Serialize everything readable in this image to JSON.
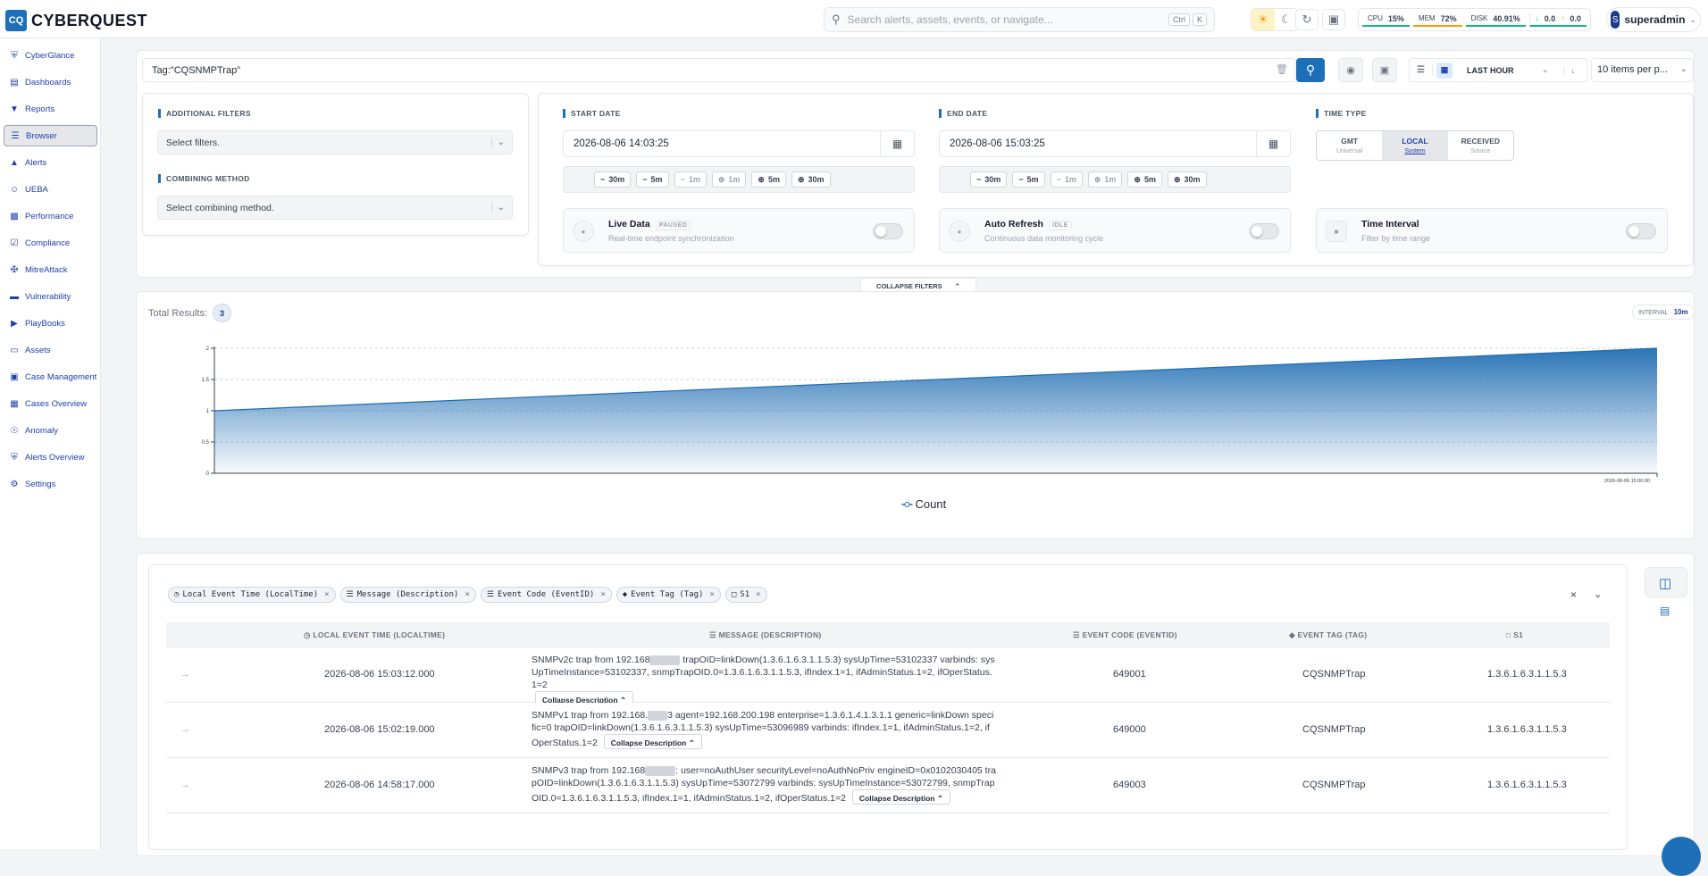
{
  "app": {
    "logo_mark": "CQ",
    "name": "CYBERQUEST"
  },
  "search": {
    "placeholder": "Search alerts, assets, events, or navigate...",
    "kbd1": "Ctrl",
    "kbd2": "K"
  },
  "metrics": [
    {
      "label": "CPU",
      "value": "15%"
    },
    {
      "label": "MEM",
      "value": "72%"
    },
    {
      "label": "DISK",
      "value": "40.91%"
    }
  ],
  "network": {
    "down": "0.0",
    "up": "0.0"
  },
  "user": {
    "initial": "S",
    "name": "superadmin"
  },
  "sidebar": {
    "items": [
      {
        "label": "CyberGlance",
        "icon": "shield-icon"
      },
      {
        "label": "Dashboards",
        "icon": "chart-icon"
      },
      {
        "label": "Reports",
        "icon": "filter-icon"
      },
      {
        "label": "Browser",
        "icon": "list-icon"
      },
      {
        "label": "Alerts",
        "icon": "bell-icon"
      },
      {
        "label": "UEBA",
        "icon": "user-icon"
      },
      {
        "label": "Performance",
        "icon": "gauge-icon"
      },
      {
        "label": "Compliance",
        "icon": "check-icon"
      },
      {
        "label": "MitreAttack",
        "icon": "target-icon"
      },
      {
        "label": "Vulnerability",
        "icon": "bug-icon"
      },
      {
        "label": "PlayBooks",
        "icon": "play-icon"
      },
      {
        "label": "Assets",
        "icon": "laptop-icon"
      },
      {
        "label": "Case Management",
        "icon": "briefcase-icon"
      },
      {
        "label": "Cases Overview",
        "icon": "grid-icon"
      },
      {
        "label": "Anomaly",
        "icon": "radar-icon"
      },
      {
        "label": "Alerts Overview",
        "icon": "shield-alert-icon"
      },
      {
        "label": "Settings",
        "icon": "gear-icon"
      }
    ],
    "active": "Browser"
  },
  "query": {
    "value": "Tag:\"CQSNMPTrap\""
  },
  "time_range": {
    "label": "LAST HOUR"
  },
  "items_per_page": {
    "label": "10 items per p..."
  },
  "filters": {
    "additional_label": "ADDITIONAL FILTERS",
    "additional_placeholder": "Select filters.",
    "combining_label": "COMBINING METHOD",
    "combining_placeholder": "Select combining method."
  },
  "start_date": {
    "label": "START DATE",
    "value": "2026-08-06 14:03:25",
    "quick": [
      "30m",
      "5m",
      "1m",
      "1m",
      "5m",
      "30m"
    ]
  },
  "end_date": {
    "label": "END DATE",
    "value": "2026-08-06 15:03:25",
    "quick": [
      "30m",
      "5m",
      "1m",
      "1m",
      "5m",
      "30m"
    ]
  },
  "time_type": {
    "label": "TIME TYPE",
    "options": [
      {
        "label": "GMT",
        "sub": "Universal"
      },
      {
        "label": "LOCAL",
        "sub": "System"
      },
      {
        "label": "RECEIVED",
        "sub": "Source"
      }
    ],
    "selected": "LOCAL"
  },
  "toggles": {
    "live": {
      "title": "Live Data",
      "badge": "PAUSED",
      "sub": "Real-time endpoint synchronization",
      "on": false
    },
    "refresh": {
      "title": "Auto Refresh",
      "badge": "IDLE",
      "sub": "Continuous data monitoring cycle",
      "on": false
    },
    "interval": {
      "title": "Time Interval",
      "sub": "Filter by time range",
      "on": false
    }
  },
  "collapse_filters": "COLLAPSE FILTERS",
  "results": {
    "label": "Total Results:",
    "count": "3"
  },
  "interval_badge": {
    "label": "INTERVAL",
    "value": "10m"
  },
  "chart_data": {
    "type": "area",
    "x": [
      "",
      "2026-08-06 15:00:00"
    ],
    "values": [
      1,
      2
    ],
    "x_tick_label": "2026-08-06 15:00:00",
    "y_ticks": [
      "2",
      "1.5",
      "1",
      "0.5",
      "0"
    ],
    "ylim": [
      0,
      2
    ],
    "grid": true,
    "legend": "Count",
    "legend_position": "bottom",
    "color": "#1f6db3"
  },
  "columns": {
    "chips": [
      {
        "label": "Local Event Time (LocalTime)",
        "icon": "clock-icon"
      },
      {
        "label": "Message (Description)",
        "icon": "list-icon"
      },
      {
        "label": "Event Code (EventID)",
        "icon": "list-ordered-icon"
      },
      {
        "label": "Event Tag (Tag)",
        "icon": "tag-icon"
      },
      {
        "label": "S1",
        "icon": "comment-icon"
      }
    ],
    "headers": [
      "LOCAL EVENT TIME (LOCALTIME)",
      "MESSAGE (DESCRIPTION)",
      "EVENT CODE (EVENTID)",
      "EVENT TAG (TAG)",
      "S1"
    ]
  },
  "collapse_description": "Collapse Description",
  "rows": [
    {
      "time": "2026-08-06 15:03:12.000",
      "msg_a": "SNMPv2c trap from 192.168",
      "msg_b": "trapOID=linkDown(1.3.6.1.6.3.1.1.5.3) sysUpTime=53102337 varbinds: sysUpTimeInstance=53102337, snmpTrapOID.0=1.3.6.1.6.3.1.1.5.3, ifIndex.1=1, ifAdminStatus.1=2, ifOperStatus.1=2",
      "code": "649001",
      "tag": "CQSNMPTrap",
      "s1": "1.3.6.1.6.3.1.1.5.3"
    },
    {
      "time": "2026-08-06 15:02:19.000",
      "msg_a": "SNMPv1 trap from 192.168.",
      "msg_b": "3 agent=192.168.200.198 enterprise=1.3.6.1.4.1.3.1.1 generic=linkDown specific=0 trapOID=linkDown(1.3.6.1.6.3.1.1.5.3) sysUpTime=53096989 varbinds: ifIndex.1=1, ifAdminStatus.1=2, ifOperStatus.1=2",
      "code": "649000",
      "tag": "CQSNMPTrap",
      "s1": "1.3.6.1.6.3.1.1.5.3"
    },
    {
      "time": "2026-08-06 14:58:17.000",
      "msg_a": "SNMPv3 trap from 192.168",
      "msg_b": ": user=noAuthUser securityLevel=noAuthNoPriv engineID=0x0102030405 trapOID=linkDown(1.3.6.1.6.3.1.1.5.3) sysUpTime=53072799 varbinds: sysUpTimeInstance=53072799, snmpTrapOID.0=1.3.6.1.6.3.1.1.5.3, ifIndex.1=1, ifAdminStatus.1=2, ifOperStatus.1=2",
      "code": "649003",
      "tag": "CQSNMPTrap",
      "s1": "1.3.6.1.6.3.1.1.5.3"
    }
  ]
}
